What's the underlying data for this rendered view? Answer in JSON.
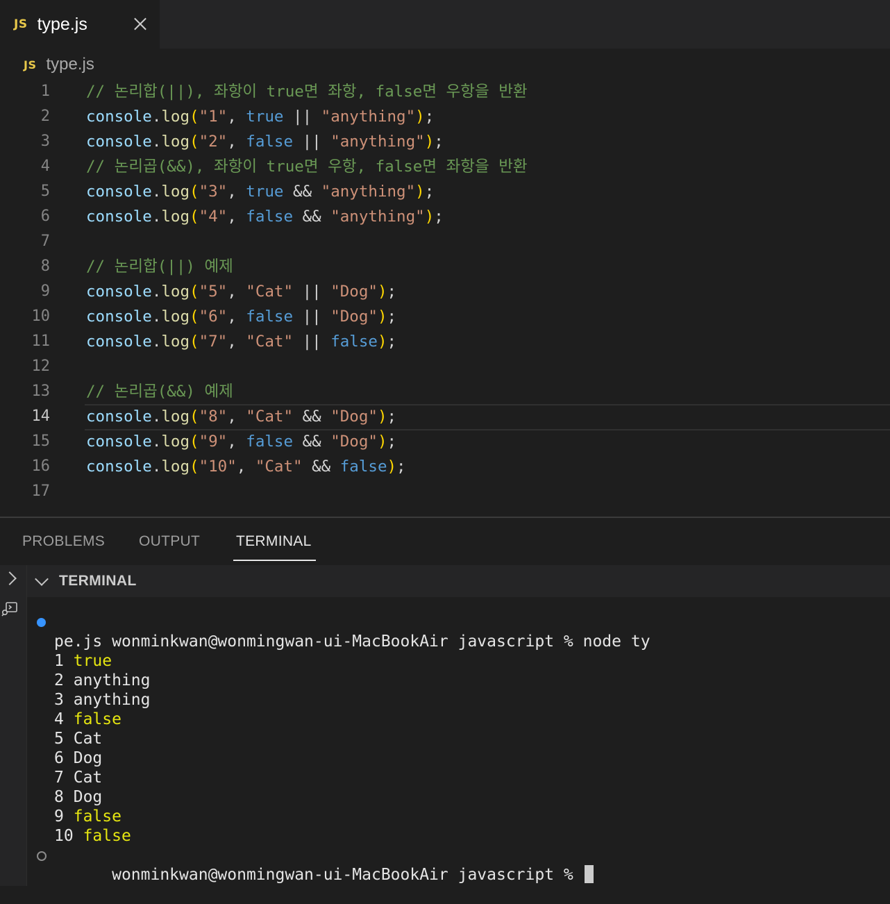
{
  "tab": {
    "badge": "JS",
    "name": "type.js"
  },
  "breadcrumb": {
    "badge": "JS",
    "file": "type.js"
  },
  "editor": {
    "active_line": 14,
    "lines": [
      {
        "n": "1",
        "tokens": [
          {
            "t": "// 논리합(||), 좌항이 true면 좌항, false면 우항을 반환",
            "c": "comment"
          }
        ]
      },
      {
        "n": "2",
        "tokens": [
          {
            "t": "console",
            "c": "var"
          },
          {
            "t": ".",
            "c": "op"
          },
          {
            "t": "log",
            "c": "fn"
          },
          {
            "t": "(",
            "c": "paren"
          },
          {
            "t": "\"1\"",
            "c": "str"
          },
          {
            "t": ", ",
            "c": "op"
          },
          {
            "t": "true",
            "c": "kw"
          },
          {
            "t": " || ",
            "c": "op"
          },
          {
            "t": "\"anything\"",
            "c": "str"
          },
          {
            "t": ")",
            "c": "paren"
          },
          {
            "t": ";",
            "c": "op"
          }
        ]
      },
      {
        "n": "3",
        "tokens": [
          {
            "t": "console",
            "c": "var"
          },
          {
            "t": ".",
            "c": "op"
          },
          {
            "t": "log",
            "c": "fn"
          },
          {
            "t": "(",
            "c": "paren"
          },
          {
            "t": "\"2\"",
            "c": "str"
          },
          {
            "t": ", ",
            "c": "op"
          },
          {
            "t": "false",
            "c": "kw"
          },
          {
            "t": " || ",
            "c": "op"
          },
          {
            "t": "\"anything\"",
            "c": "str"
          },
          {
            "t": ")",
            "c": "paren"
          },
          {
            "t": ";",
            "c": "op"
          }
        ]
      },
      {
        "n": "4",
        "tokens": [
          {
            "t": "// 논리곱(&&), 좌항이 true면 우항, false면 좌항을 반환",
            "c": "comment"
          }
        ]
      },
      {
        "n": "5",
        "tokens": [
          {
            "t": "console",
            "c": "var"
          },
          {
            "t": ".",
            "c": "op"
          },
          {
            "t": "log",
            "c": "fn"
          },
          {
            "t": "(",
            "c": "paren"
          },
          {
            "t": "\"3\"",
            "c": "str"
          },
          {
            "t": ", ",
            "c": "op"
          },
          {
            "t": "true",
            "c": "kw"
          },
          {
            "t": " && ",
            "c": "op"
          },
          {
            "t": "\"anything\"",
            "c": "str"
          },
          {
            "t": ")",
            "c": "paren"
          },
          {
            "t": ";",
            "c": "op"
          }
        ]
      },
      {
        "n": "6",
        "tokens": [
          {
            "t": "console",
            "c": "var"
          },
          {
            "t": ".",
            "c": "op"
          },
          {
            "t": "log",
            "c": "fn"
          },
          {
            "t": "(",
            "c": "paren"
          },
          {
            "t": "\"4\"",
            "c": "str"
          },
          {
            "t": ", ",
            "c": "op"
          },
          {
            "t": "false",
            "c": "kw"
          },
          {
            "t": " && ",
            "c": "op"
          },
          {
            "t": "\"anything\"",
            "c": "str"
          },
          {
            "t": ")",
            "c": "paren"
          },
          {
            "t": ";",
            "c": "op"
          }
        ]
      },
      {
        "n": "7",
        "tokens": []
      },
      {
        "n": "8",
        "tokens": [
          {
            "t": "// 논리합(||) 예제",
            "c": "comment"
          }
        ]
      },
      {
        "n": "9",
        "tokens": [
          {
            "t": "console",
            "c": "var"
          },
          {
            "t": ".",
            "c": "op"
          },
          {
            "t": "log",
            "c": "fn"
          },
          {
            "t": "(",
            "c": "paren"
          },
          {
            "t": "\"5\"",
            "c": "str"
          },
          {
            "t": ", ",
            "c": "op"
          },
          {
            "t": "\"Cat\"",
            "c": "str"
          },
          {
            "t": " || ",
            "c": "op"
          },
          {
            "t": "\"Dog\"",
            "c": "str"
          },
          {
            "t": ")",
            "c": "paren"
          },
          {
            "t": ";",
            "c": "op"
          }
        ]
      },
      {
        "n": "10",
        "tokens": [
          {
            "t": "console",
            "c": "var"
          },
          {
            "t": ".",
            "c": "op"
          },
          {
            "t": "log",
            "c": "fn"
          },
          {
            "t": "(",
            "c": "paren"
          },
          {
            "t": "\"6\"",
            "c": "str"
          },
          {
            "t": ", ",
            "c": "op"
          },
          {
            "t": "false",
            "c": "kw"
          },
          {
            "t": " || ",
            "c": "op"
          },
          {
            "t": "\"Dog\"",
            "c": "str"
          },
          {
            "t": ")",
            "c": "paren"
          },
          {
            "t": ";",
            "c": "op"
          }
        ]
      },
      {
        "n": "11",
        "tokens": [
          {
            "t": "console",
            "c": "var"
          },
          {
            "t": ".",
            "c": "op"
          },
          {
            "t": "log",
            "c": "fn"
          },
          {
            "t": "(",
            "c": "paren"
          },
          {
            "t": "\"7\"",
            "c": "str"
          },
          {
            "t": ", ",
            "c": "op"
          },
          {
            "t": "\"Cat\"",
            "c": "str"
          },
          {
            "t": " || ",
            "c": "op"
          },
          {
            "t": "false",
            "c": "kw"
          },
          {
            "t": ")",
            "c": "paren"
          },
          {
            "t": ";",
            "c": "op"
          }
        ]
      },
      {
        "n": "12",
        "tokens": []
      },
      {
        "n": "13",
        "tokens": [
          {
            "t": "// 논리곱(&&) 예제",
            "c": "comment"
          }
        ]
      },
      {
        "n": "14",
        "tokens": [
          {
            "t": "console",
            "c": "var"
          },
          {
            "t": ".",
            "c": "op"
          },
          {
            "t": "log",
            "c": "fn"
          },
          {
            "t": "(",
            "c": "paren"
          },
          {
            "t": "\"8\"",
            "c": "str"
          },
          {
            "t": ", ",
            "c": "op"
          },
          {
            "t": "\"Cat\"",
            "c": "str"
          },
          {
            "t": " && ",
            "c": "op"
          },
          {
            "t": "\"Dog\"",
            "c": "str"
          },
          {
            "t": ")",
            "c": "paren"
          },
          {
            "t": ";",
            "c": "op"
          }
        ]
      },
      {
        "n": "15",
        "tokens": [
          {
            "t": "console",
            "c": "var"
          },
          {
            "t": ".",
            "c": "op"
          },
          {
            "t": "log",
            "c": "fn"
          },
          {
            "t": "(",
            "c": "paren"
          },
          {
            "t": "\"9\"",
            "c": "str"
          },
          {
            "t": ", ",
            "c": "op"
          },
          {
            "t": "false",
            "c": "kw"
          },
          {
            "t": " && ",
            "c": "op"
          },
          {
            "t": "\"Dog\"",
            "c": "str"
          },
          {
            "t": ")",
            "c": "paren"
          },
          {
            "t": ";",
            "c": "op"
          }
        ]
      },
      {
        "n": "16",
        "tokens": [
          {
            "t": "console",
            "c": "var"
          },
          {
            "t": ".",
            "c": "op"
          },
          {
            "t": "log",
            "c": "fn"
          },
          {
            "t": "(",
            "c": "paren"
          },
          {
            "t": "\"10\"",
            "c": "str"
          },
          {
            "t": ", ",
            "c": "op"
          },
          {
            "t": "\"Cat\"",
            "c": "str"
          },
          {
            "t": " && ",
            "c": "op"
          },
          {
            "t": "false",
            "c": "kw"
          },
          {
            "t": ")",
            "c": "paren"
          },
          {
            "t": ";",
            "c": "op"
          }
        ]
      },
      {
        "n": "17",
        "tokens": []
      }
    ]
  },
  "panel": {
    "tabs": [
      {
        "label": "PROBLEMS",
        "active": false
      },
      {
        "label": "OUTPUT",
        "active": false
      },
      {
        "label": "TERMINAL",
        "active": true
      }
    ],
    "section_title": "TERMINAL"
  },
  "terminal": {
    "command_prompt": "wonminkwan@wonmingwan-ui-MacBookAir javascript % node ty",
    "command_wrap": "pe.js",
    "output": [
      {
        "label": "1",
        "value": "true",
        "highlight": true
      },
      {
        "label": "2",
        "value": "anything",
        "highlight": false
      },
      {
        "label": "3",
        "value": "anything",
        "highlight": false
      },
      {
        "label": "4",
        "value": "false",
        "highlight": true
      },
      {
        "label": "5",
        "value": "Cat",
        "highlight": false
      },
      {
        "label": "6",
        "value": "Dog",
        "highlight": false
      },
      {
        "label": "7",
        "value": "Cat",
        "highlight": false
      },
      {
        "label": "8",
        "value": "Dog",
        "highlight": false
      },
      {
        "label": "9",
        "value": "false",
        "highlight": true
      },
      {
        "label": "10",
        "value": "false",
        "highlight": true
      }
    ],
    "final_prompt": "wonminkwan@wonmingwan-ui-MacBookAir javascript % "
  },
  "icons": {
    "tab_close": "close-icon",
    "panel_toggle": "chevron-right-icon",
    "section_toggle": "chevron-down-icon",
    "terminal_side": "terminal-icon"
  },
  "colors": {
    "comment": "#6a9955",
    "variable": "#9cdcfe",
    "function": "#dcdcaa",
    "string": "#ce9178",
    "keyword": "#569cd6",
    "bracket": "#ffd700",
    "terminal_highlight": "#e5e510",
    "status_dot": "#3794ff"
  }
}
